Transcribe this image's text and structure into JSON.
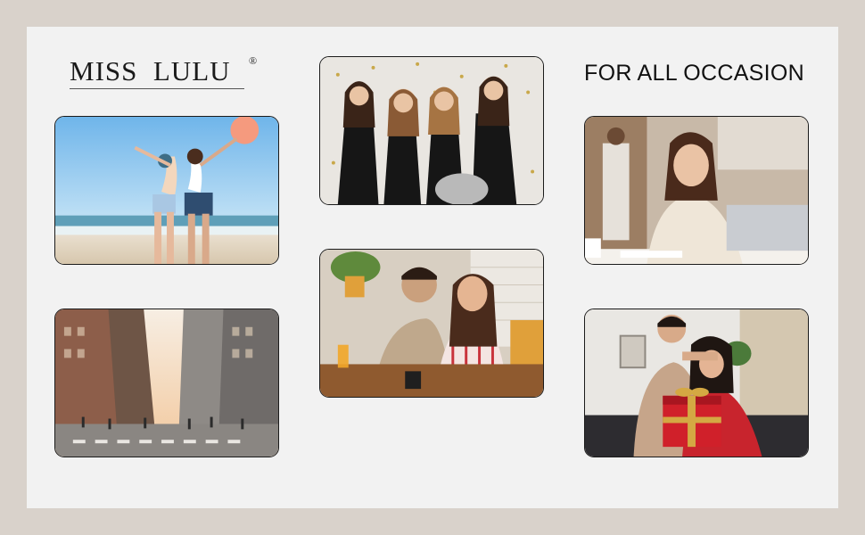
{
  "brand": {
    "name": "MISS  LULU",
    "registered_mark": "®"
  },
  "tagline": "FOR ALL OCCASION",
  "photos": [
    {
      "id": "beach-friends",
      "subject": "two women waving on a beach"
    },
    {
      "id": "party-friends",
      "subject": "four women celebrating with champagne"
    },
    {
      "id": "woman-laptop",
      "subject": "woman smiling at phone beside laptop"
    },
    {
      "id": "city-street",
      "subject": "busy city crosswalk between tall buildings"
    },
    {
      "id": "couple-cafe",
      "subject": "couple looking at a phone at a cafe table"
    },
    {
      "id": "gift-surprise",
      "subject": "man covering woman's eyes while she holds a red gift box"
    }
  ],
  "colors": {
    "background": "#d9d2cb",
    "panel": "#f2f2f2",
    "gift_red": "#d0202a",
    "gift_ribbon": "#d4a843"
  }
}
